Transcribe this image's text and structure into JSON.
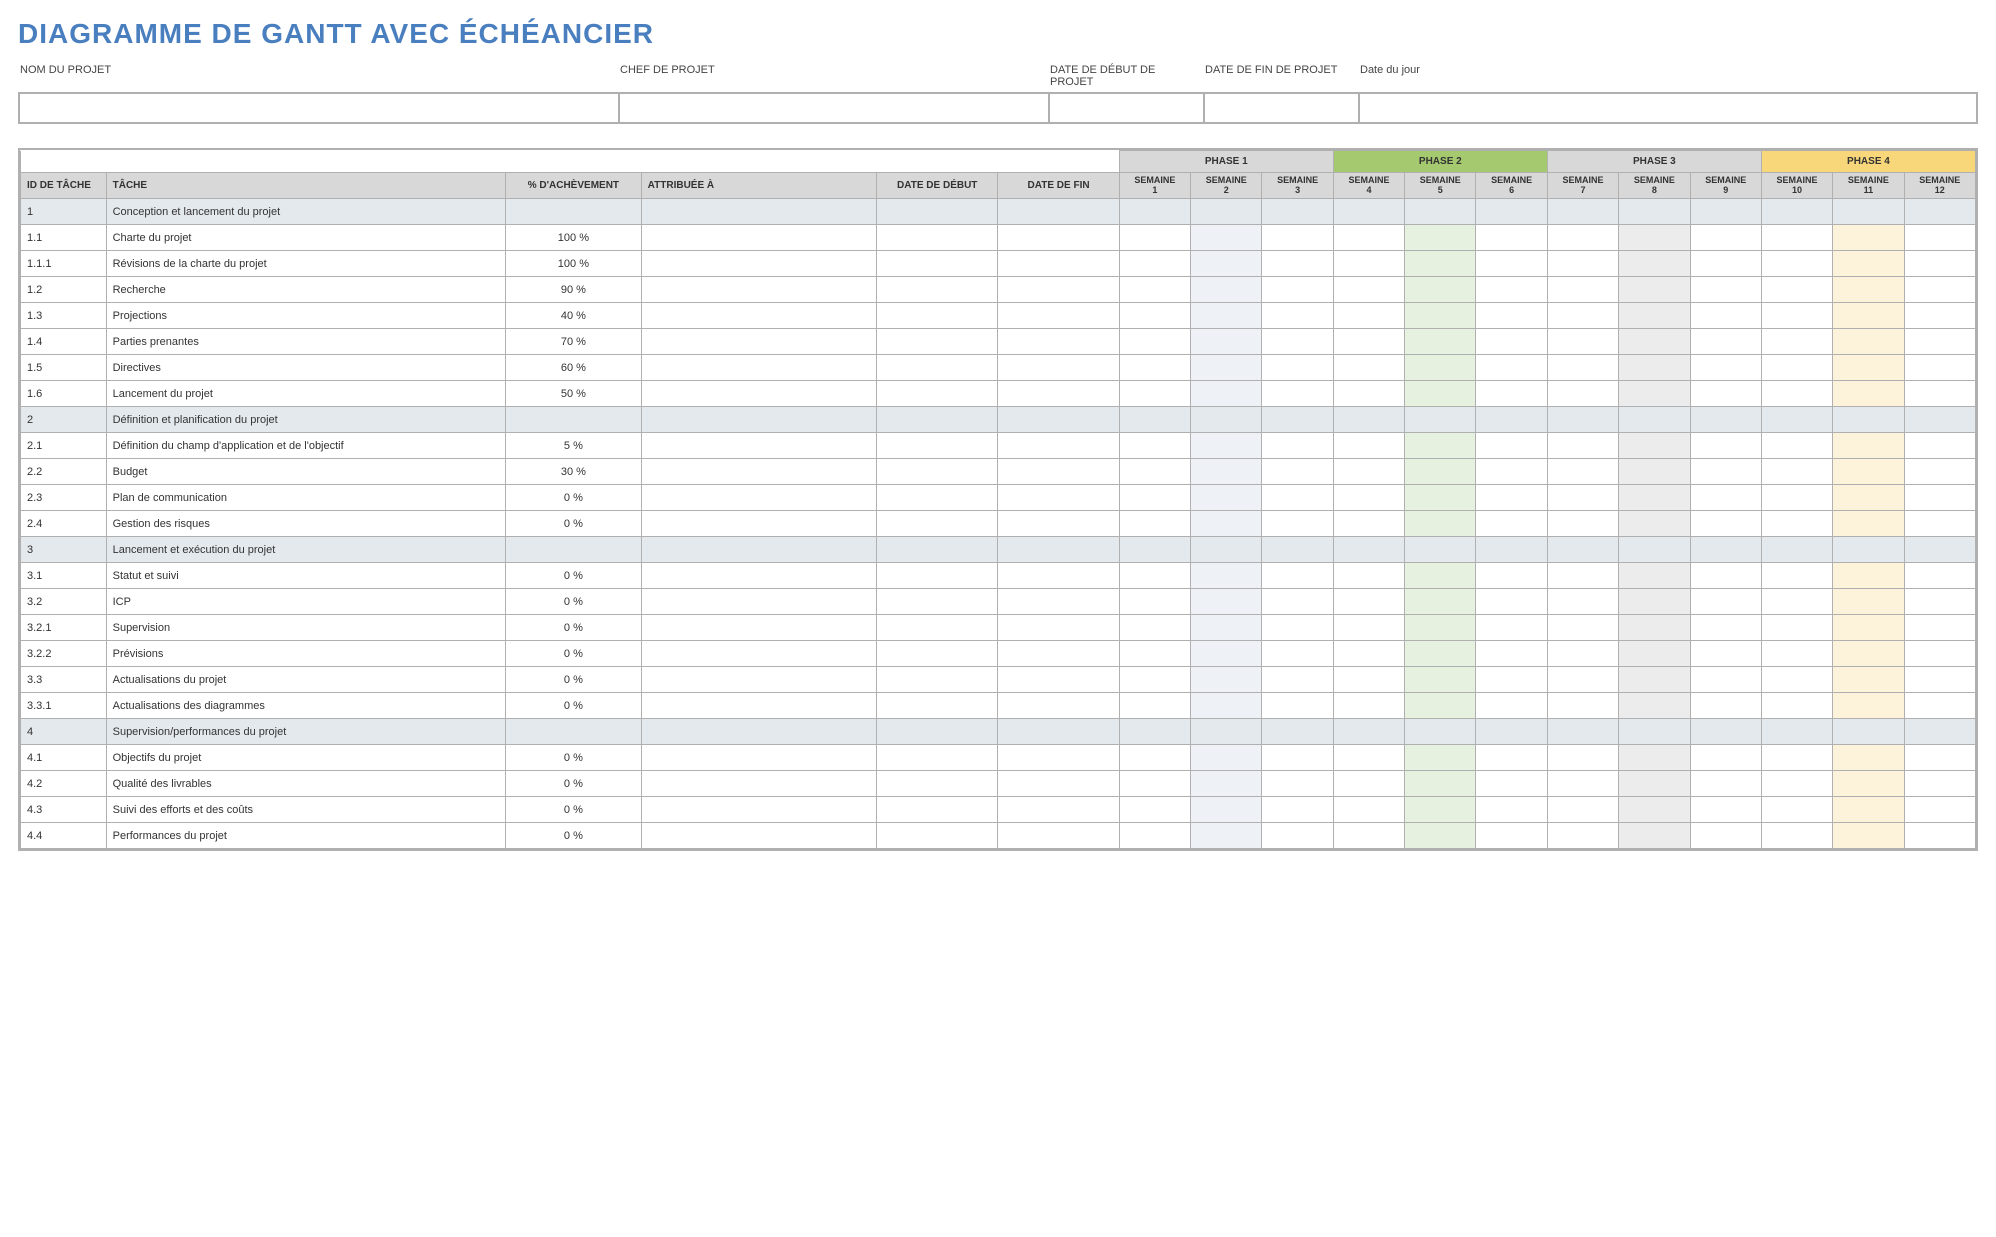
{
  "title": "DIAGRAMME DE GANTT AVEC ÉCHÉANCIER",
  "meta": {
    "labels": {
      "project_name": "NOM DU PROJET",
      "project_lead": "CHEF DE PROJET",
      "start_date": "DATE DE DÉBUT DE PROJET",
      "end_date": "DATE DE FIN DE PROJET",
      "today": "Date du jour"
    },
    "values": {
      "project_name": "",
      "project_lead": "",
      "start_date": "",
      "end_date": "",
      "today": ""
    }
  },
  "columns": {
    "id": "ID DE TÂCHE",
    "task": "TÂCHE",
    "pct": "% D'ACHÈVEMENT",
    "attr": "ATTRIBUÉE À",
    "start": "DATE DE DÉBUT",
    "end": "DATE DE FIN"
  },
  "phases": [
    {
      "label": "PHASE 1",
      "class": "phase1"
    },
    {
      "label": "PHASE 2",
      "class": "phase2"
    },
    {
      "label": "PHASE 3",
      "class": "phase3"
    },
    {
      "label": "PHASE 4",
      "class": "phase4"
    }
  ],
  "week_label": "SEMAINE",
  "weeks": [
    "1",
    "2",
    "3",
    "4",
    "5",
    "6",
    "7",
    "8",
    "9",
    "10",
    "11",
    "12"
  ],
  "rows": [
    {
      "id": "1",
      "task": "Conception et lancement du projet",
      "pct": "",
      "section": true
    },
    {
      "id": "1.1",
      "task": "Charte du projet",
      "pct": "100 %",
      "section": false
    },
    {
      "id": "1.1.1",
      "task": "Révisions de la charte du projet",
      "pct": "100 %",
      "section": false
    },
    {
      "id": "1.2",
      "task": "Recherche",
      "pct": "90 %",
      "section": false
    },
    {
      "id": "1.3",
      "task": "Projections",
      "pct": "40 %",
      "section": false
    },
    {
      "id": "1.4",
      "task": "Parties prenantes",
      "pct": "70 %",
      "section": false
    },
    {
      "id": "1.5",
      "task": "Directives",
      "pct": "60 %",
      "section": false
    },
    {
      "id": "1.6",
      "task": "Lancement du projet",
      "pct": "50 %",
      "section": false
    },
    {
      "id": "2",
      "task": "Définition et planification du projet",
      "pct": "",
      "section": true
    },
    {
      "id": "2.1",
      "task": "Définition du champ d'application et de l'objectif",
      "pct": "5 %",
      "section": false
    },
    {
      "id": "2.2",
      "task": "Budget",
      "pct": "30 %",
      "section": false
    },
    {
      "id": "2.3",
      "task": "Plan de communication",
      "pct": "0 %",
      "section": false
    },
    {
      "id": "2.4",
      "task": "Gestion des risques",
      "pct": "0 %",
      "section": false
    },
    {
      "id": "3",
      "task": "Lancement et exécution du projet",
      "pct": "",
      "section": true
    },
    {
      "id": "3.1",
      "task": "Statut et suivi",
      "pct": "0 %",
      "section": false
    },
    {
      "id": "3.2",
      "task": "ICP",
      "pct": "0 %",
      "section": false
    },
    {
      "id": "3.2.1",
      "task": "Supervision",
      "pct": "0 %",
      "section": false
    },
    {
      "id": "3.2.2",
      "task": "Prévisions",
      "pct": "0 %",
      "section": false
    },
    {
      "id": "3.3",
      "task": "Actualisations du projet",
      "pct": "0 %",
      "section": false
    },
    {
      "id": "3.3.1",
      "task": "Actualisations des diagrammes",
      "pct": "0 %",
      "section": false
    },
    {
      "id": "4",
      "task": "Supervision/performances du projet",
      "pct": "",
      "section": true
    },
    {
      "id": "4.1",
      "task": "Objectifs du projet",
      "pct": "0 %",
      "section": false
    },
    {
      "id": "4.2",
      "task": "Qualité des livrables",
      "pct": "0 %",
      "section": false
    },
    {
      "id": "4.3",
      "task": "Suivi des efforts et des coûts",
      "pct": "0 %",
      "section": false
    },
    {
      "id": "4.4",
      "task": "Performances du projet",
      "pct": "0 %",
      "section": false
    }
  ]
}
